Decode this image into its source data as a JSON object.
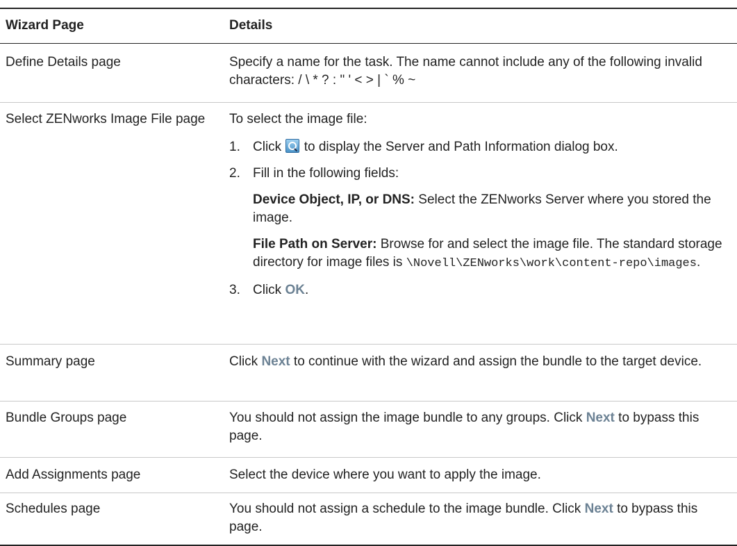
{
  "table": {
    "headers": {
      "col1": "Wizard Page",
      "col2": "Details"
    },
    "rows": {
      "define": {
        "page": "Define Details page",
        "text": "Specify a name for the task. The name cannot include any of the following invalid characters: / \\ * ? : \" ' < > | ` % ~"
      },
      "select": {
        "page": "Select ZENworks Image File page",
        "intro": "To select the image file:",
        "step1_num": "1.",
        "step1_pre": "Click",
        "step1_post": "to display the Server and Path Information dialog box.",
        "step2_num": "2.",
        "step2_text": "Fill in the following fields:",
        "field1_label": "Device Object, IP, or DNS:",
        "field1_text": "Select the ZENworks Server where you stored the image.",
        "field2_label": "File Path on Server:",
        "field2_text": "Browse for and select the image file. The standard storage directory for image files is",
        "field2_path": "\\Novell\\ZENworks\\work\\content-repo\\images",
        "field2_end": ".",
        "step3_num": "3.",
        "step3_pre": "Click",
        "step3_ui": "OK",
        "step3_end": "."
      },
      "summary": {
        "page": "Summary page",
        "pre": "Click",
        "ui": "Next",
        "post": "to continue with the wizard and assign the bundle to the target device."
      },
      "groups": {
        "page": "Bundle Groups page",
        "pre": "You should not assign the image bundle to any groups. Click",
        "ui": "Next",
        "post": "to bypass this page."
      },
      "assign": {
        "page": "Add Assignments page",
        "text": "Select the device where you want to apply the image."
      },
      "schedules": {
        "page": "Schedules page",
        "pre": "You should not assign a schedule to the image bundle. Click",
        "ui": "Next",
        "post": "to bypass this page."
      }
    }
  },
  "icons": {
    "browse": "search-icon"
  }
}
